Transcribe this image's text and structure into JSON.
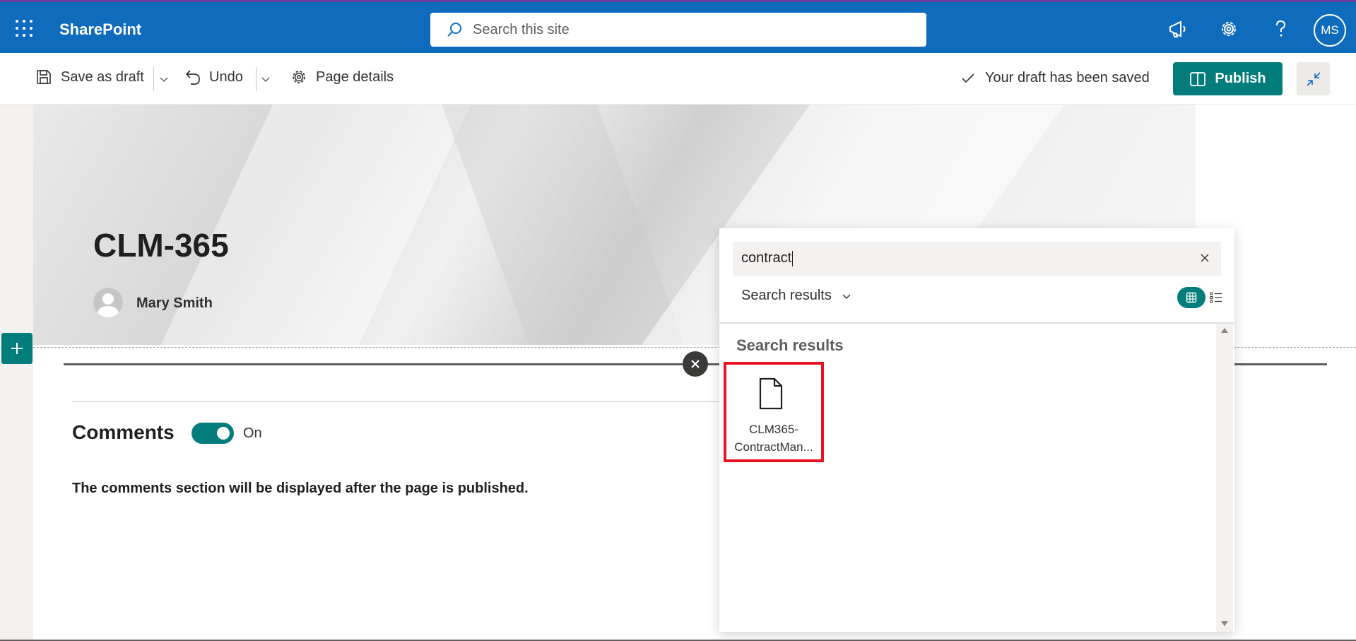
{
  "suitebar": {
    "brand": "SharePoint",
    "search_placeholder": "Search this site",
    "avatar_initials": "MS",
    "icons": [
      "waffle-icon",
      "megaphone-icon",
      "gear-icon",
      "help-icon"
    ]
  },
  "toolbar": {
    "save_draft_label": "Save as draft",
    "undo_label": "Undo",
    "page_details_label": "Page details",
    "saved_status": "Your draft has been saved",
    "publish_label": "Publish"
  },
  "page": {
    "title": "CLM-365",
    "author": "Mary Smith"
  },
  "comments": {
    "title": "Comments",
    "toggle_label": "On",
    "toggle_on": true,
    "note": "The comments section will be displayed after the page is published."
  },
  "file_picker": {
    "search_value": "contract",
    "scope_label": "Search results",
    "results_title": "Search results",
    "results": [
      {
        "name_line1": "CLM365-",
        "name_line2": "ContractMan...",
        "icon": "document-icon"
      }
    ]
  },
  "colors": {
    "suitebar": "#0f6cbd",
    "accent": "#037c7c",
    "highlight": "#e81123"
  }
}
